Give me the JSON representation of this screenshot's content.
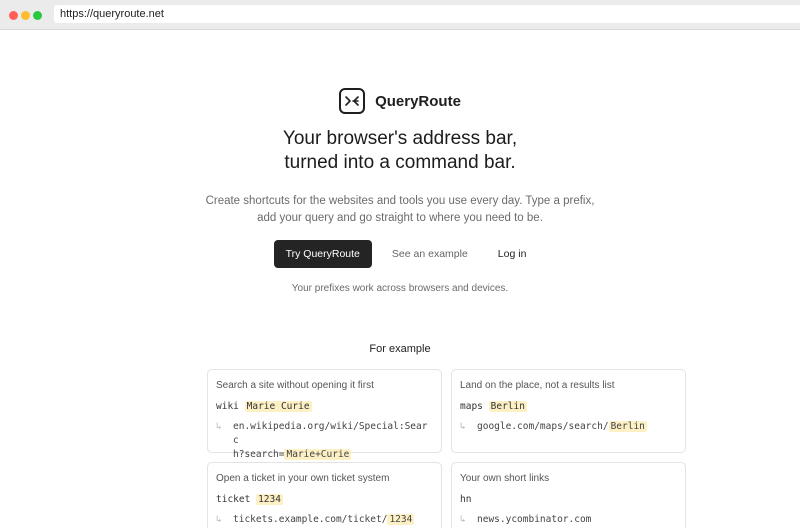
{
  "browser": {
    "url": "https://queryroute.net"
  },
  "brand": {
    "name": "QueryRoute"
  },
  "hero": {
    "headline_line1": "Your browser's address bar,",
    "headline_line2": "turned into a command bar.",
    "sub_line1": "Create shortcuts for the websites and tools you use every day. Type a prefix,",
    "sub_line2": "add your query and go straight to where you need to be.",
    "try_button": "Try QueryRoute",
    "example_link": "See an example",
    "login_link": "Log in",
    "note": "Your prefixes work across browsers and devices."
  },
  "examples": {
    "title": "For example",
    "arrow": "↳",
    "cards": [
      {
        "title": "Search a site without opening it first",
        "prefix": "wiki",
        "query": "Marie Curie",
        "url_lines": [
          "en.wikipedia.org/wiki/Special:Searc",
          "h?search="
        ],
        "url_query": "Marie+Curie"
      },
      {
        "title": "Land on the place, not a results list",
        "prefix": "maps",
        "query": "Berlin",
        "url_base": "google.com/maps/search/",
        "url_query": "Berlin"
      },
      {
        "title": "Open a ticket in your own ticket system",
        "prefix": "ticket",
        "query": "1234",
        "url_base": "tickets.example.com/ticket/",
        "url_query": "1234"
      },
      {
        "title": "Your own short links",
        "prefix": "hn",
        "url_base": "news.ycombinator.com"
      }
    ]
  }
}
